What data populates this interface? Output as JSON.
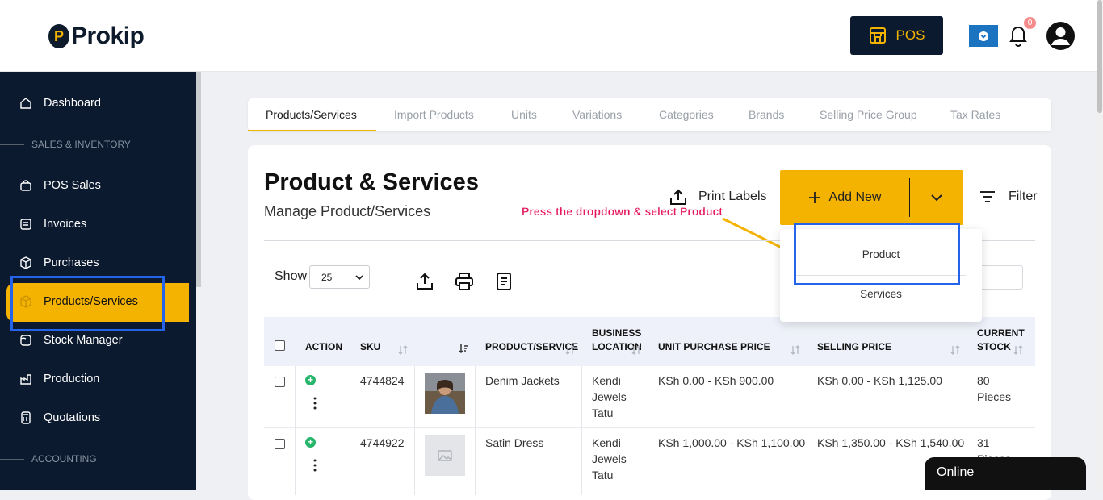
{
  "brand": {
    "name": "Prokip",
    "mark": "P"
  },
  "header": {
    "pos_label": "POS",
    "notification_count": "0"
  },
  "sidebar": {
    "items": [
      {
        "label": "Dashboard",
        "icon": "home-icon"
      },
      {
        "label": "POS Sales",
        "icon": "bag-icon"
      },
      {
        "label": "Invoices",
        "icon": "invoice-icon"
      },
      {
        "label": "Purchases",
        "icon": "box-icon"
      },
      {
        "label": "Products/Services",
        "icon": "cube-icon",
        "active": true
      },
      {
        "label": "Stock Manager",
        "icon": "stock-icon"
      },
      {
        "label": "Production",
        "icon": "factory-icon"
      },
      {
        "label": "Quotations",
        "icon": "calculator-icon"
      }
    ],
    "sections": [
      "SALES & INVENTORY",
      "ACCOUNTING"
    ]
  },
  "tabs": [
    "Products/Services",
    "Import Products",
    "Units",
    "Variations",
    "Categories",
    "Brands",
    "Selling Price Group",
    "Tax Rates"
  ],
  "page": {
    "title": "Product & Services",
    "subtitle": "Manage Product/Services",
    "print_labels": "Print Labels",
    "add_new": "Add New",
    "filter": "Filter",
    "hint": "Press the dropdown & select Product"
  },
  "dropdown": {
    "items": [
      "Product",
      "Services"
    ]
  },
  "table_controls": {
    "show_label": "Show",
    "page_size": "25"
  },
  "table": {
    "headers": {
      "action": "ACTION",
      "sku": "SKU",
      "product": "PRODUCT/SERVICE",
      "location_1": "BUSINESS",
      "location_2": "LOCATION",
      "unit_purchase": "UNIT PURCHASE PRICE",
      "selling": "SELLING PRICE",
      "stock_1": "CURRENT",
      "stock_2": "STOCK"
    },
    "rows": [
      {
        "sku": "4744824",
        "name": "Denim Jackets",
        "loc_1": "Kendi",
        "loc_2": "Jewels",
        "loc_3": "Tatu",
        "purchase": "KSh 0.00 - KSh 900.00",
        "selling": "KSh 0.00 - KSh 1,125.00",
        "stock_1": "80",
        "stock_2": "Pieces"
      },
      {
        "sku": "4744922",
        "name": "Satin Dress",
        "loc_1": "Kendi",
        "loc_2": "Jewels",
        "loc_3": "Tatu",
        "purchase": "KSh 1,000.00 - KSh 1,100.00",
        "selling": "KSh 1,350.00 - KSh 1,540.00",
        "stock_1": "31",
        "stock_2": "Pieces"
      }
    ]
  },
  "chat": {
    "status": "Online"
  },
  "colors": {
    "accent": "#f5b301",
    "navy": "#0c1a2f",
    "highlight": "#2563eb",
    "hint": "#e5175d"
  }
}
